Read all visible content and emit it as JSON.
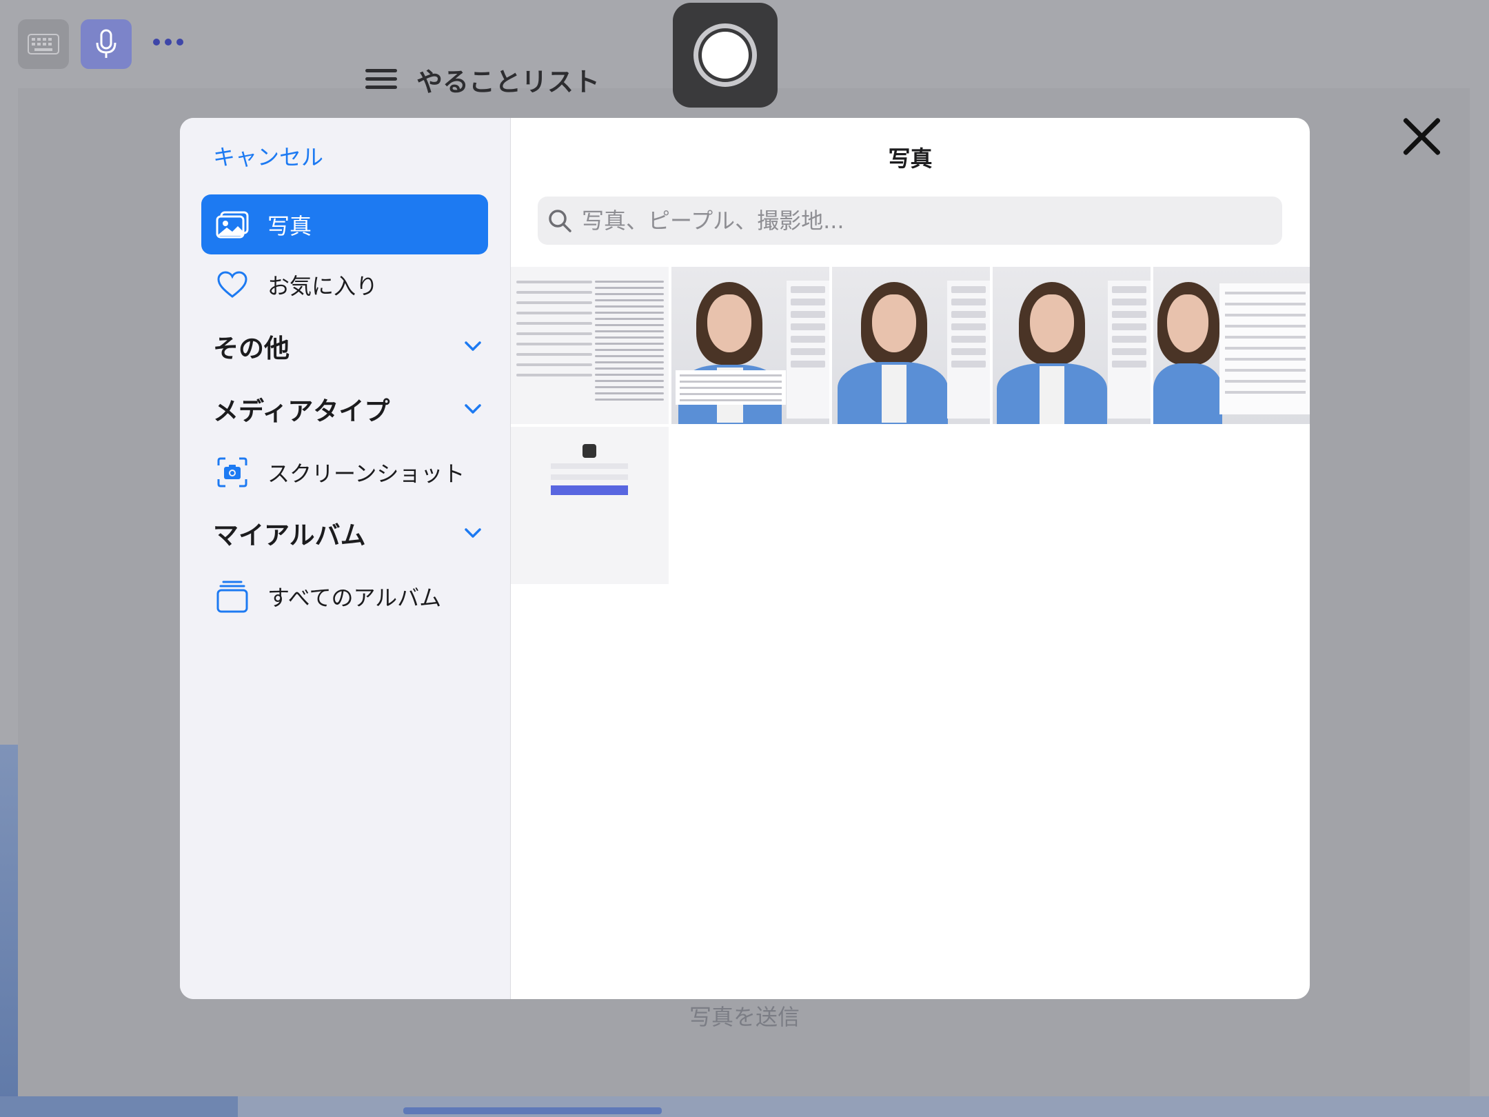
{
  "background": {
    "title": "やることリスト",
    "send_label": "写真を送信"
  },
  "toolbar": {
    "keyboard_icon": "keyboard-icon",
    "mic_icon": "mic-icon",
    "more_icon": "more-icon"
  },
  "recording": {
    "icon": "record-icon"
  },
  "close": {
    "icon": "close-icon"
  },
  "picker": {
    "cancel_label": "キャンセル",
    "title": "写真",
    "search": {
      "placeholder": "写真、ピープル、撮影地...",
      "value": ""
    },
    "sidebar": {
      "items": [
        {
          "label": "写真",
          "icon": "photos-icon",
          "active": true
        },
        {
          "label": "お気に入り",
          "icon": "heart-icon",
          "active": false
        }
      ],
      "sections": [
        {
          "label": "その他"
        },
        {
          "label": "メディアタイプ",
          "items": [
            {
              "label": "スクリーンショット",
              "icon": "screenshot-icon"
            }
          ]
        },
        {
          "label": "マイアルバム",
          "items": [
            {
              "label": "すべてのアルバム",
              "icon": "albums-icon"
            }
          ]
        }
      ]
    },
    "thumbnails": [
      {
        "kind": "document-screenshot"
      },
      {
        "kind": "avatar-screenshot"
      },
      {
        "kind": "avatar-screenshot"
      },
      {
        "kind": "avatar-screenshot"
      },
      {
        "kind": "avatar-table-screenshot"
      },
      {
        "kind": "login-screenshot"
      }
    ]
  },
  "colors": {
    "accent": "#1d7af2",
    "sidebar_bg": "#f2f2f7"
  }
}
